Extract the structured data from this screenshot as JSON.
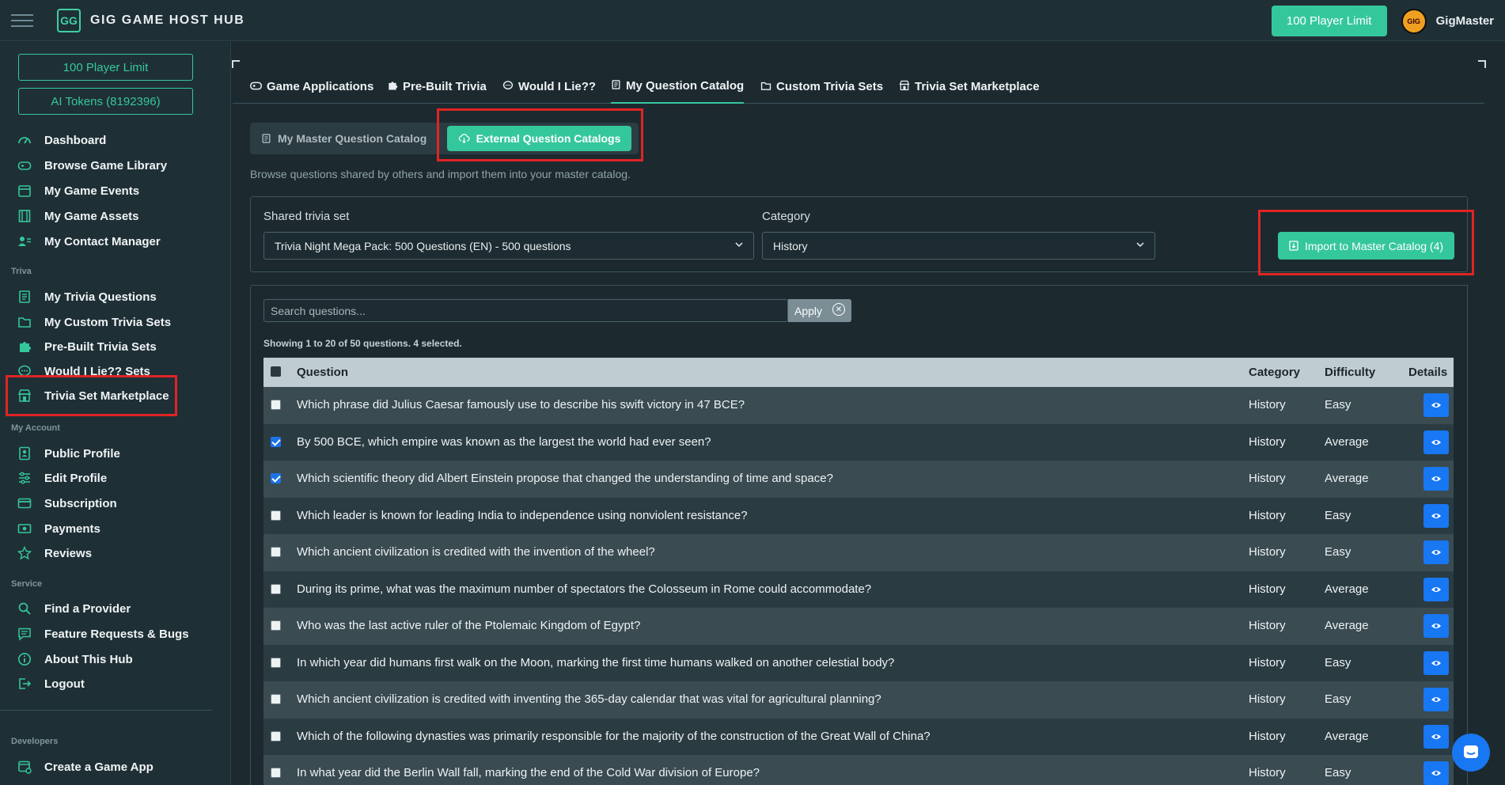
{
  "app": {
    "title": "GIG GAME HOST HUB",
    "logo_text": "GG",
    "player_limit_button": "100 Player Limit",
    "username": "GigMaster",
    "avatar_text": "GIG"
  },
  "sidebar": {
    "player_limit": "100 Player Limit",
    "ai_tokens": "AI Tokens (8192396)",
    "main_items": [
      {
        "label": "Dashboard",
        "icon": "dashboard-icon"
      },
      {
        "label": "Browse Game Library",
        "icon": "gamepad-icon"
      },
      {
        "label": "My Game Events",
        "icon": "calendar-icon"
      },
      {
        "label": "My Game Assets",
        "icon": "film-icon"
      },
      {
        "label": "My Contact Manager",
        "icon": "contacts-icon"
      }
    ],
    "trivia_label": "Triva",
    "trivia_items": [
      {
        "label": "My Trivia Questions",
        "icon": "list-icon"
      },
      {
        "label": "My Custom Trivia Sets",
        "icon": "folder-icon"
      },
      {
        "label": "Pre-Built Trivia Sets",
        "icon": "puzzle-icon"
      },
      {
        "label": "Would I Lie?? Sets",
        "icon": "chat-icon"
      },
      {
        "label": "Trivia Set Marketplace",
        "icon": "store-icon"
      }
    ],
    "account_label": "My Account",
    "account_items": [
      {
        "label": "Public Profile",
        "icon": "profile-icon"
      },
      {
        "label": "Edit Profile",
        "icon": "sliders-icon"
      },
      {
        "label": "Subscription",
        "icon": "card-icon"
      },
      {
        "label": "Payments",
        "icon": "money-icon"
      },
      {
        "label": "Reviews",
        "icon": "star-icon"
      }
    ],
    "service_label": "Service",
    "service_items": [
      {
        "label": "Find a Provider",
        "icon": "search-icon"
      },
      {
        "label": "Feature Requests & Bugs",
        "icon": "message-icon"
      },
      {
        "label": "About This Hub",
        "icon": "info-icon"
      },
      {
        "label": "Logout",
        "icon": "logout-icon"
      }
    ],
    "developers_label": "Developers",
    "developer_items": [
      {
        "label": "Create a Game App",
        "icon": "app-icon"
      }
    ]
  },
  "tabs": [
    {
      "label": "Game Applications",
      "icon": "gamepad-icon"
    },
    {
      "label": "Pre-Built Trivia",
      "icon": "puzzle-icon"
    },
    {
      "label": "Would I Lie??",
      "icon": "chat-icon"
    },
    {
      "label": "My Question Catalog",
      "icon": "list-icon",
      "active": true
    },
    {
      "label": "Custom Trivia Sets",
      "icon": "folder-icon"
    },
    {
      "label": "Trivia Set Marketplace",
      "icon": "store-icon"
    }
  ],
  "subtabs": {
    "master": "My Master Question Catalog",
    "external": "External Question Catalogs"
  },
  "help_text": "Browse questions shared by others and import them into your master catalog.",
  "filters": {
    "shared_label": "Shared trivia set",
    "shared_value": "Trivia Night Mega Pack: 500 Questions (EN) - 500 questions",
    "category_label": "Category",
    "category_value": "History",
    "import_button": "Import to Master Catalog (4)"
  },
  "search": {
    "placeholder": "Search questions...",
    "apply": "Apply"
  },
  "showing_text": "Showing 1 to 20 of 50 questions. 4 selected.",
  "table": {
    "headers": {
      "question": "Question",
      "category": "Category",
      "difficulty": "Difficulty",
      "details": "Details"
    },
    "rows": [
      {
        "question": "Which phrase did Julius Caesar famously use to describe his swift victory in 47 BCE?",
        "category": "History",
        "difficulty": "Easy",
        "checked": false
      },
      {
        "question": "By 500 BCE, which empire was known as the largest the world had ever seen?",
        "category": "History",
        "difficulty": "Average",
        "checked": true
      },
      {
        "question": "Which scientific theory did Albert Einstein propose that changed the understanding of time and space?",
        "category": "History",
        "difficulty": "Average",
        "checked": true
      },
      {
        "question": "Which leader is known for leading India to independence using nonviolent resistance?",
        "category": "History",
        "difficulty": "Easy",
        "checked": false
      },
      {
        "question": "Which ancient civilization is credited with the invention of the wheel?",
        "category": "History",
        "difficulty": "Easy",
        "checked": false
      },
      {
        "question": "During its prime, what was the maximum number of spectators the Colosseum in Rome could accommodate?",
        "category": "History",
        "difficulty": "Average",
        "checked": false
      },
      {
        "question": "Who was the last active ruler of the Ptolemaic Kingdom of Egypt?",
        "category": "History",
        "difficulty": "Average",
        "checked": false
      },
      {
        "question": "In which year did humans first walk on the Moon, marking the first time humans walked on another celestial body?",
        "category": "History",
        "difficulty": "Easy",
        "checked": false
      },
      {
        "question": "Which ancient civilization is credited with inventing the 365-day calendar that was vital for agricultural planning?",
        "category": "History",
        "difficulty": "Easy",
        "checked": false
      },
      {
        "question": "Which of the following dynasties was primarily responsible for the majority of the construction of the Great Wall of China?",
        "category": "History",
        "difficulty": "Average",
        "checked": false
      },
      {
        "question": "In what year did the Berlin Wall fall, marking the end of the Cold War division of Europe?",
        "category": "History",
        "difficulty": "Easy",
        "checked": false
      }
    ]
  },
  "colors": {
    "accent": "#35c79c",
    "highlight": "#e02424",
    "eye_button": "#1877f2"
  }
}
